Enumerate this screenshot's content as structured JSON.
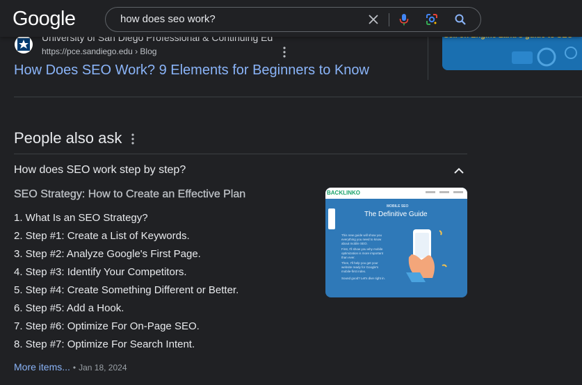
{
  "header": {
    "logo": "Google",
    "search": {
      "value": "how does seo work?",
      "placeholder": ""
    }
  },
  "result": {
    "site_name": "University of San Diego Professional & Continuing Ed",
    "site_url": "https://pce.sandiego.edu › Blog",
    "title": "How Does SEO Work? 9 Elements for Beginners to Know",
    "thumbnail_text": "Sell on Engine Land's guide to SEO"
  },
  "paa": {
    "heading": "People also ask",
    "question": "How does SEO work step by step?",
    "answer_title": "SEO Strategy: How to Create an Effective Plan",
    "steps": [
      "1. What Is an SEO Strategy?",
      "2. Step #1: Create a List of Keywords.",
      "3. Step #2: Analyze Google's First Page.",
      "4. Step #3: Identify Your Competitors.",
      "5. Step #4: Create Something Different or Better.",
      "6. Step #5: Add a Hook.",
      "7. Step #6: Optimize For On-Page SEO.",
      "8. Step #7: Optimize For Search Intent."
    ],
    "more_items": "More items...",
    "separator": "•",
    "date": "Jan 18, 2024",
    "image": {
      "brand": "BACKLINKO",
      "subtitle": "MOBILE SEO",
      "title": "The Definitive Guide",
      "text_1": "This new guide will show you everything you need to know about mobile SEO.",
      "text_2": "First, I'll show you why mobile optimization is more important than ever.",
      "text_3": "Then, I'll help you get your website ready for Google's mobile-first index.",
      "text_4": "Sound good? Let's dive right in."
    }
  },
  "colors": {
    "background": "#202124",
    "link": "#8ab4f8",
    "text": "#e8eaed",
    "muted": "#9aa0a6"
  }
}
